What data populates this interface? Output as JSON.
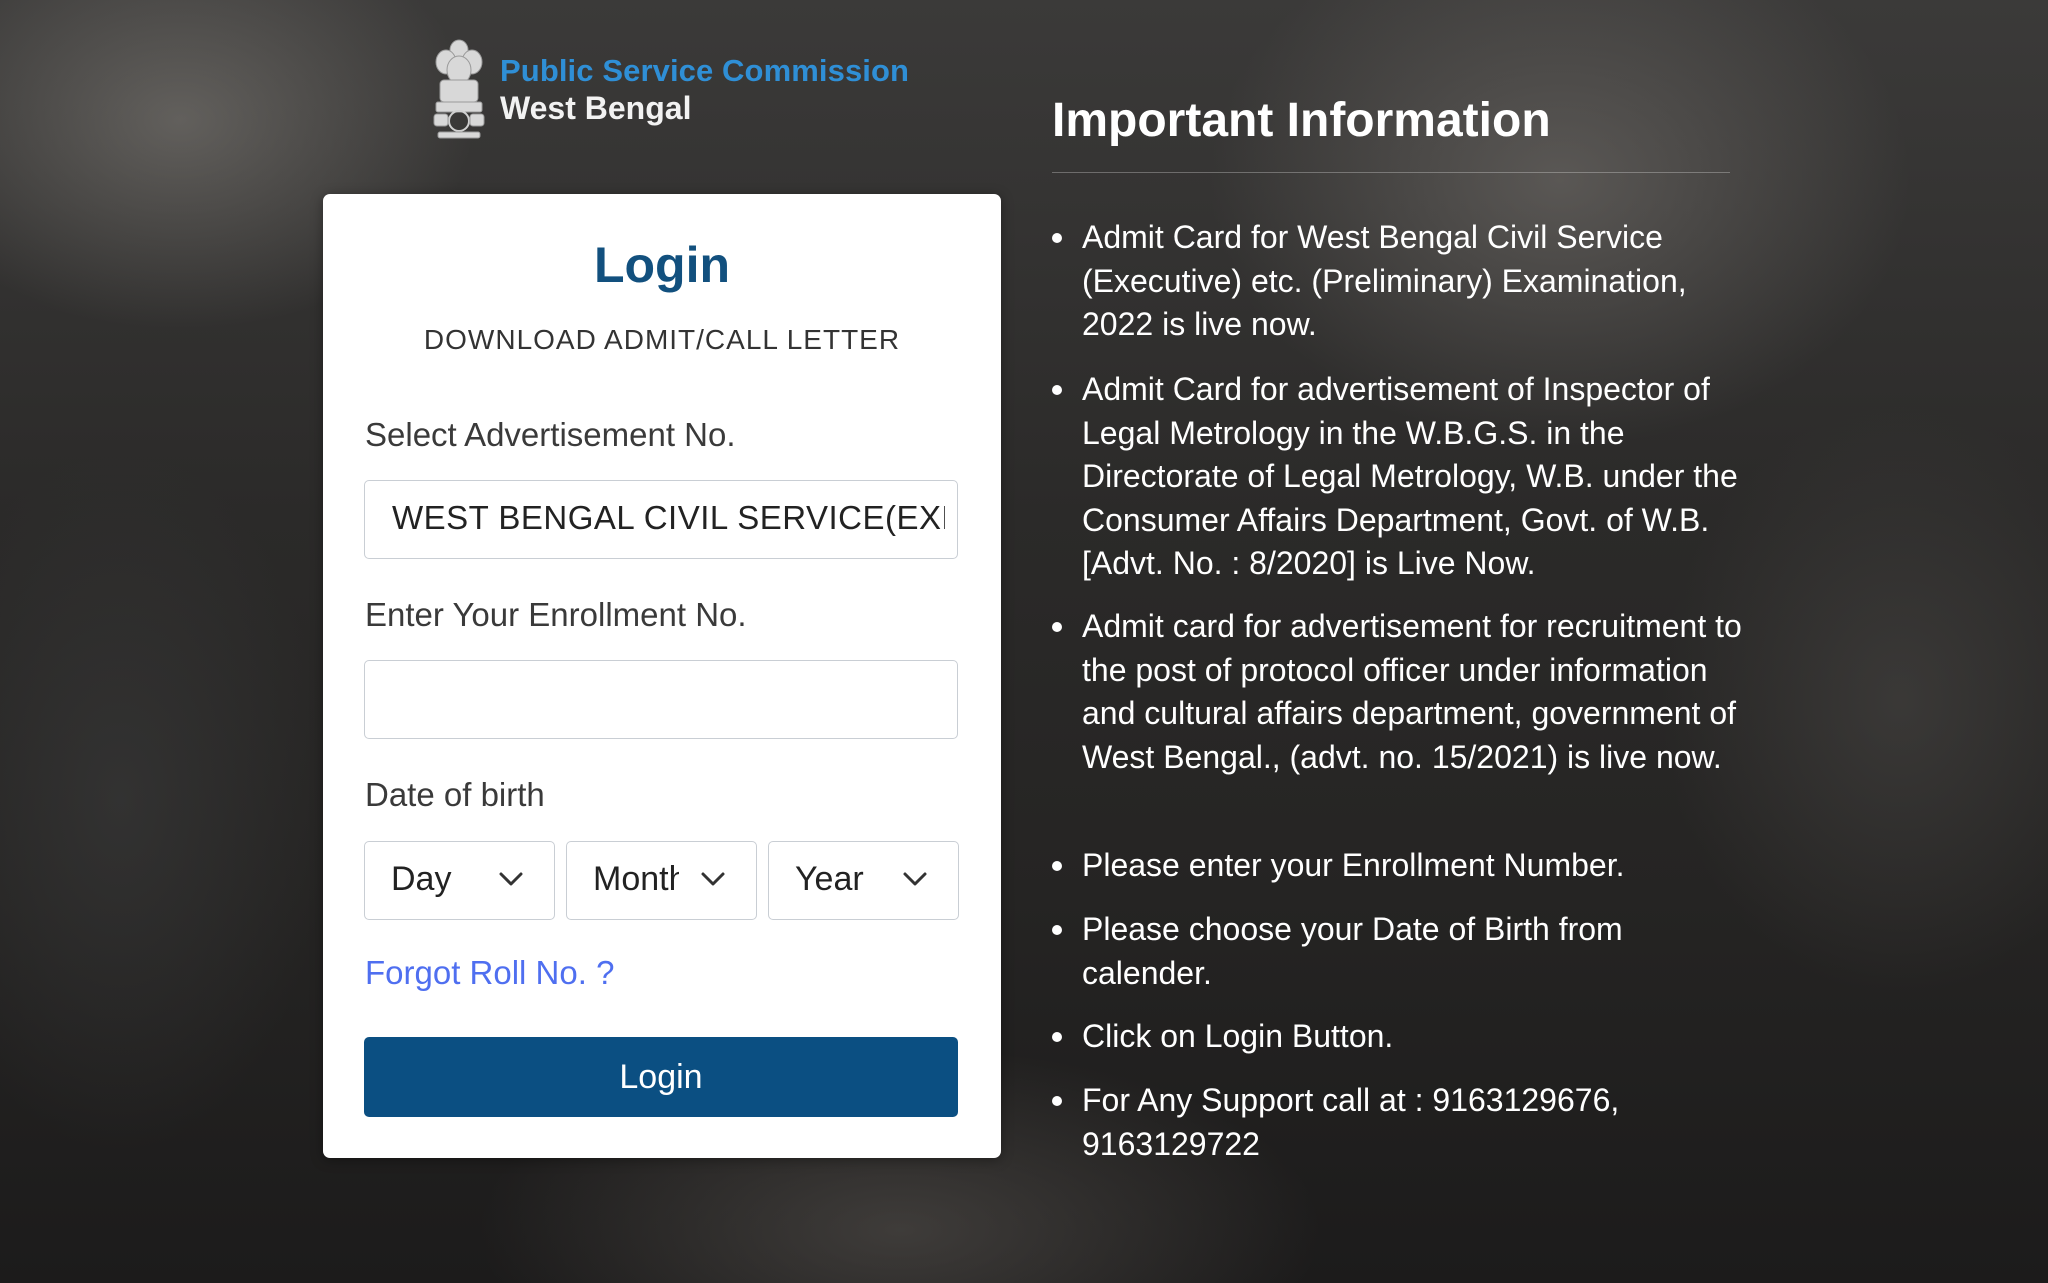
{
  "brand": {
    "line1": "Public Service Commission",
    "line2": "West Bengal"
  },
  "login_card": {
    "title": "Login",
    "subtitle": "DOWNLOAD ADMIT/CALL LETTER",
    "advertisement": {
      "label": "Select Advertisement No.",
      "value": "WEST BENGAL CIVIL SERVICE(EXECUTIVE)"
    },
    "enrollment": {
      "label": "Enter Your Enrollment No.",
      "value": ""
    },
    "dob": {
      "label": "Date of birth",
      "day": "Day",
      "month": "Month",
      "year": "Year"
    },
    "forgot_link": "Forgot Roll No. ?",
    "login_button": "Login"
  },
  "info": {
    "title": "Important Information",
    "items": [
      "Admit Card for West Bengal Civil Service (Executive) etc. (Preliminary) Examination, 2022 is live now.",
      "Admit Card for advertisement of Inspector of Legal Metrology in the W.B.G.S. in the Directorate of Legal Metrology, W.B. under the Consumer Affairs Department, Govt. of W.B. [Advt. No. : 8/2020] is Live Now.",
      "Admit card for advertisement for recruitment to the post of protocol officer under information and cultural affairs department, government of West Bengal., (advt. no. 15/2021) is live now.",
      "Please enter your Enrollment Number.",
      "Please choose your Date of Birth from calender.",
      "Click on Login Button.",
      "For Any Support call at : 9163129676, 9163129722"
    ]
  },
  "colors": {
    "brand_blue": "#2f8fd6",
    "title_blue": "#12507e",
    "button_blue": "#0b4f82",
    "link_blue": "#4f6ff0"
  },
  "icons": [
    "national-emblem-icon",
    "chevron-down-icon"
  ]
}
